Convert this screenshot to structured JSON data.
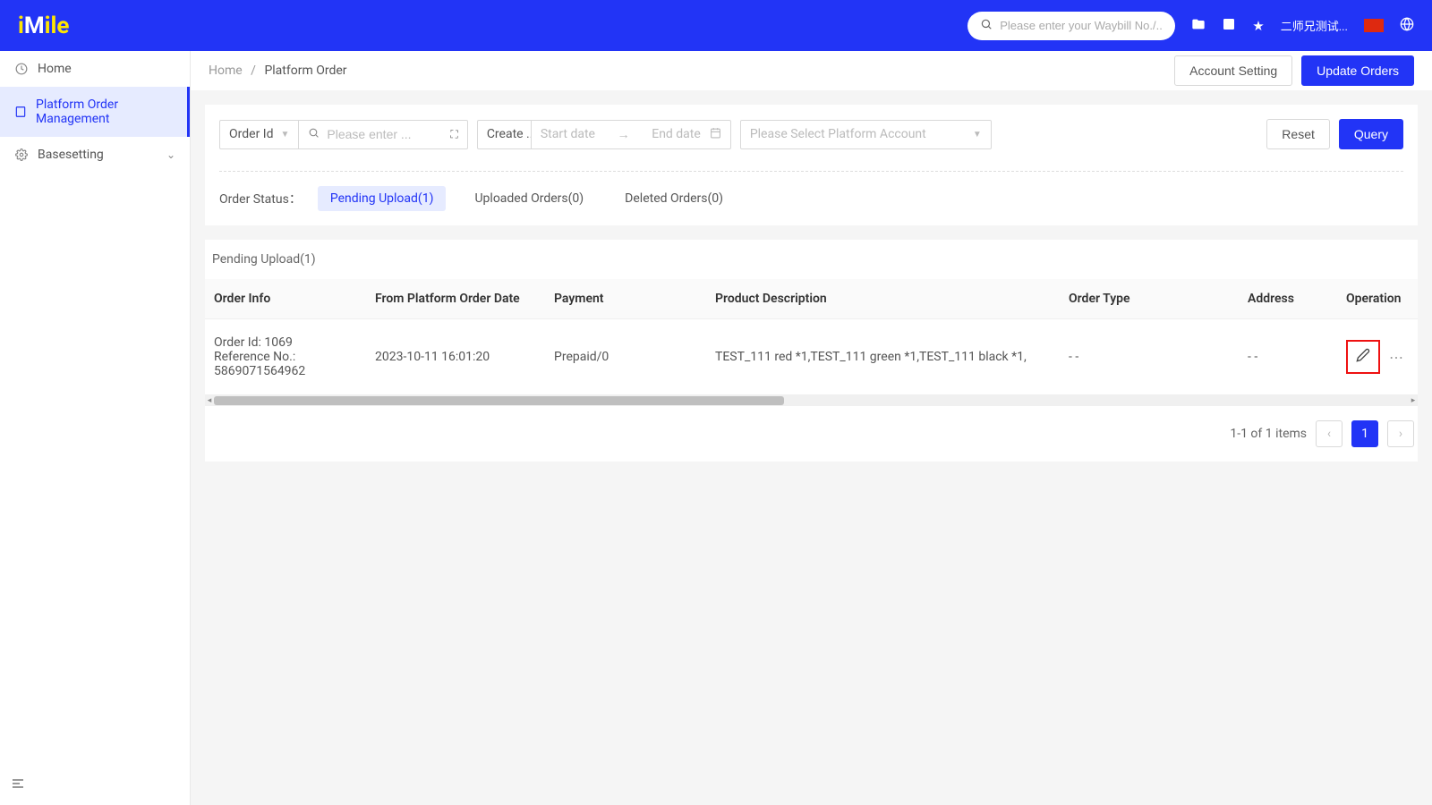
{
  "header": {
    "search_placeholder": "Please enter your Waybill No./...",
    "username": "二师兄测试..."
  },
  "sidebar": {
    "items": [
      {
        "icon": "clock",
        "label": "Home"
      },
      {
        "icon": "doc",
        "label": "Platform Order Management"
      },
      {
        "icon": "gear",
        "label": "Basesetting"
      }
    ]
  },
  "breadcrumb": {
    "home": "Home",
    "current": "Platform Order"
  },
  "actions": {
    "account": "Account Setting",
    "update": "Update Orders"
  },
  "filters": {
    "orderid_label": "Order Id",
    "orderid_placeholder": "Please enter ...",
    "create_label": "Create ...",
    "start_date": "Start date",
    "end_date": "End date",
    "platform_placeholder": "Please Select Platform Account",
    "reset": "Reset",
    "query": "Query"
  },
  "status": {
    "label": "Order Status：",
    "tabs": [
      {
        "text": "Pending Upload(1)"
      },
      {
        "text": "Uploaded Orders(0)"
      },
      {
        "text": "Deleted Orders(0)"
      }
    ]
  },
  "section_title": "Pending Upload(1)",
  "table": {
    "headers": {
      "info": "Order Info",
      "date": "From Platform Order Date",
      "payment": "Payment",
      "product": "Product Description",
      "type": "Order Type",
      "address": "Address",
      "operation": "Operation"
    },
    "rows": [
      {
        "info_line1": "Order Id: 1069",
        "info_line2": "Reference No.: 5869071564962",
        "date": "2023-10-11 16:01:20",
        "payment": "Prepaid/0",
        "product": "TEST_111 red *1,TEST_111 green *1,TEST_111 black *1,",
        "type": "- -",
        "address": "- -"
      }
    ]
  },
  "pagination": {
    "text": "1-1 of 1 items",
    "page": "1"
  }
}
